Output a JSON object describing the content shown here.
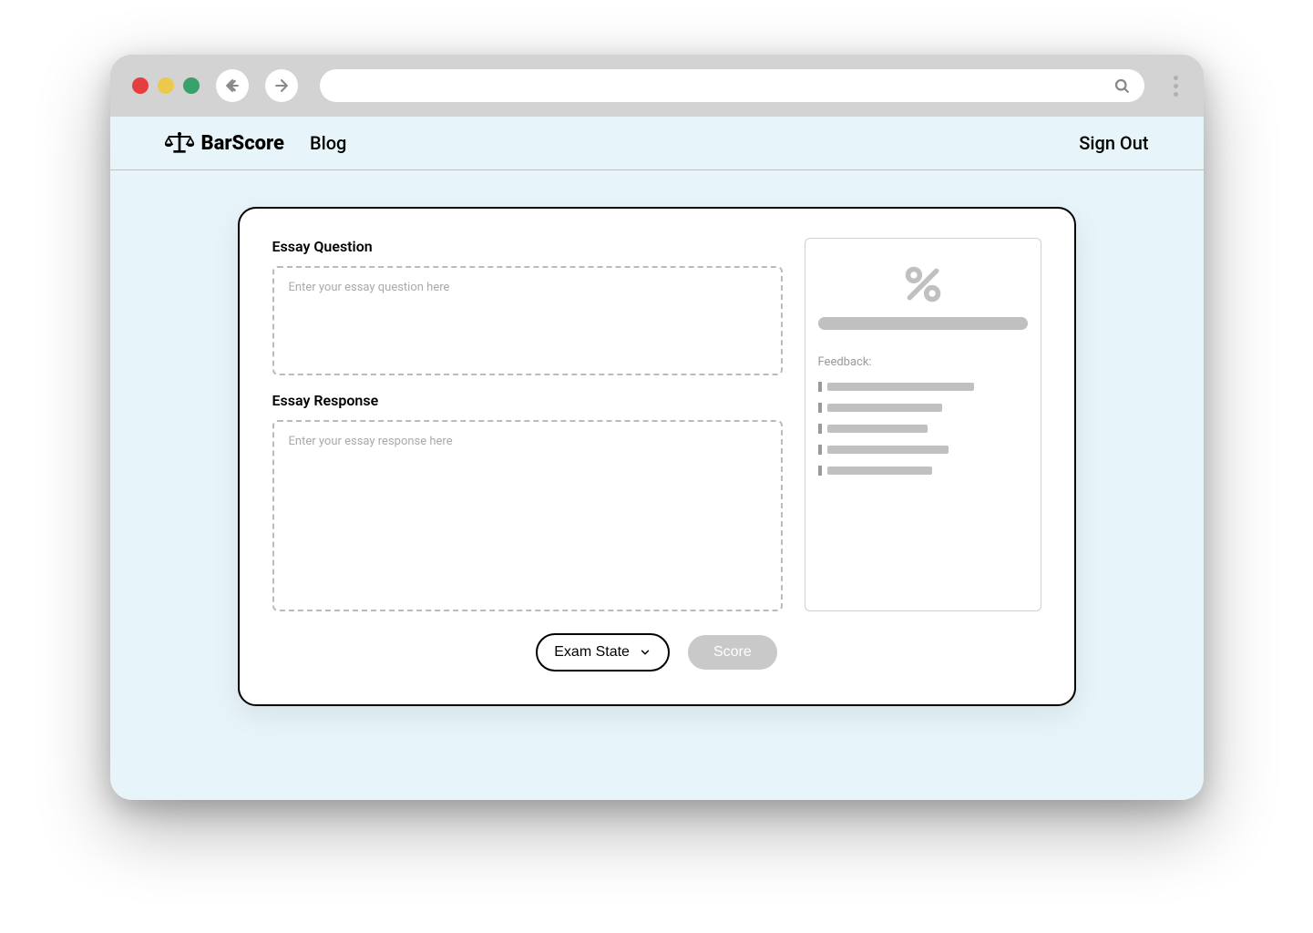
{
  "header": {
    "brand_name": "BarScore",
    "nav": {
      "blog_label": "Blog"
    },
    "sign_out_label": "Sign Out"
  },
  "form": {
    "question_label": "Essay Question",
    "question_placeholder": "Enter your essay question here",
    "response_label": "Essay Response",
    "response_placeholder": "Enter your essay response here"
  },
  "results": {
    "score_symbol": "%",
    "feedback_label": "Feedback:"
  },
  "actions": {
    "dropdown_label": "Exam State",
    "score_button_label": "Score"
  }
}
